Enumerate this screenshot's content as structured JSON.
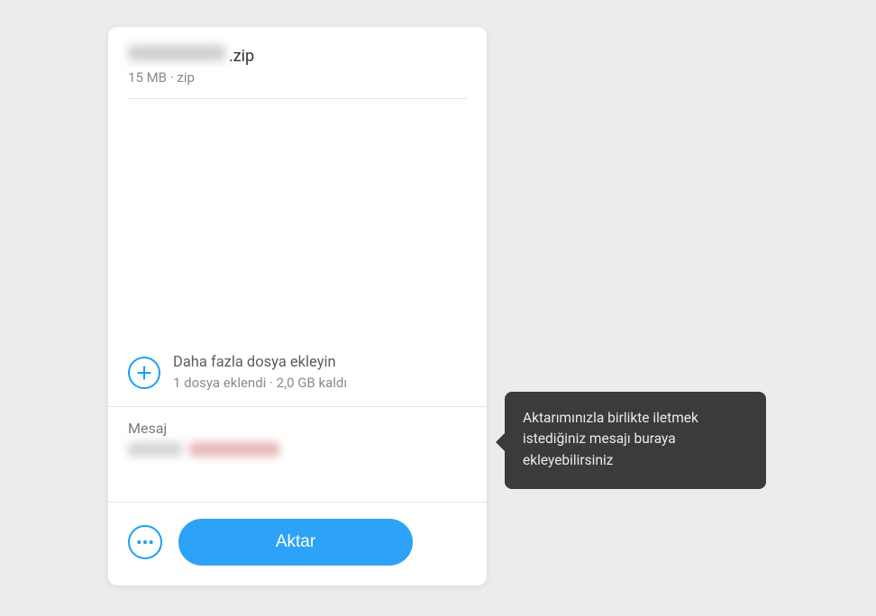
{
  "file": {
    "name_visible_part": ".zip",
    "size": "15 MB",
    "type": "zip",
    "meta_separator": " · "
  },
  "add_more": {
    "title": "Daha fazla dosya ekleyin",
    "subtitle": "1 dosya eklendi · 2,0 GB kaldı"
  },
  "message": {
    "label": "Mesaj"
  },
  "footer": {
    "transfer_label": "Aktar"
  },
  "tooltip": {
    "text": "Aktarımınızla birlikte iletmek istediğiniz mesajı buraya ekleyebilirsiniz"
  },
  "colors": {
    "accent": "#2da3f7",
    "accent_border": "#1aa0f8",
    "tooltip_bg": "#3b3b3b"
  }
}
